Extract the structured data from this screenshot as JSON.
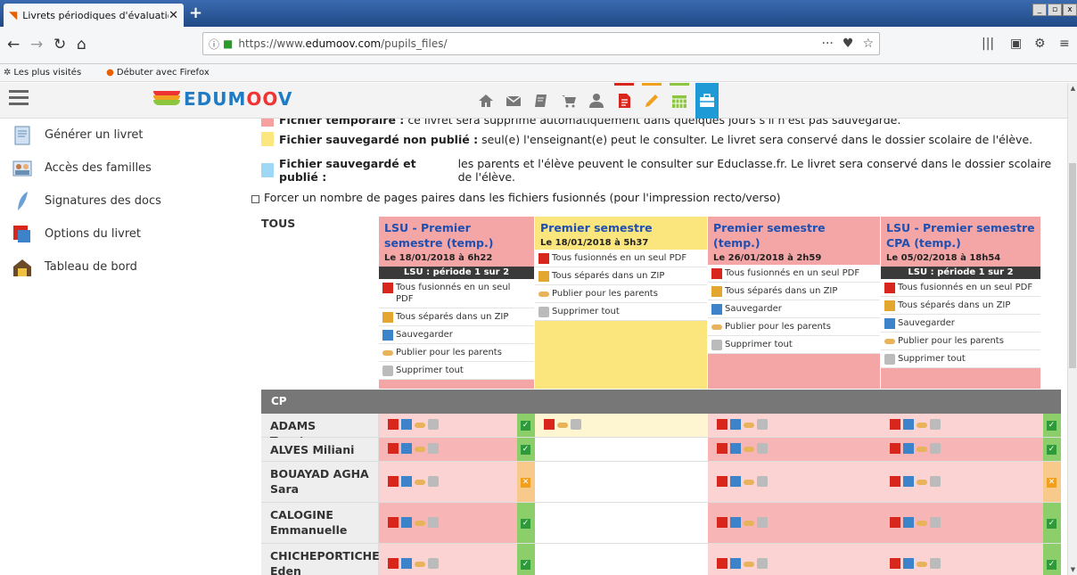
{
  "browser": {
    "tab_title": "Livrets périodiques d'évaluations :",
    "tab_close": "✕",
    "new_tab": "+",
    "url_prefix": "https://www.",
    "url_domain": "edumoov.com",
    "url_path": "/pupils_files/",
    "url_more": "···",
    "bookmarks": [
      "Les plus visités",
      "Débuter avec Firefox"
    ]
  },
  "app": {
    "logo_prefix": "EDUM",
    "logo_oo": "OO",
    "logo_suffix": "V",
    "nav_icons": [
      "home-icon",
      "mail-icon",
      "notebook-icon",
      "cart-icon",
      "user-icon",
      "document-icon",
      "pencil-icon",
      "calendar-icon",
      "briefcase-icon"
    ],
    "nav_colors": {
      "document": "#d9261c",
      "pencil": "#f0a01e",
      "calendar": "#8cc63f",
      "briefcase": "#1e9ad6"
    }
  },
  "sidebar": {
    "items": [
      {
        "label": "Générer un livret",
        "icon": "report-icon"
      },
      {
        "label": "Accès des familles",
        "icon": "family-icon"
      },
      {
        "label": "Signatures des docs",
        "icon": "feather-icon"
      },
      {
        "label": "Options du livret",
        "icon": "options-icon"
      },
      {
        "label": "Tableau de bord",
        "icon": "dashboard-icon"
      }
    ]
  },
  "legend": {
    "temp": {
      "title": "Fichier temporaire :",
      "text": "ce livret sera supprimé automatiquement dans quelques jours s'il n'est pas sauvegardé.",
      "color": "#f7a0a0"
    },
    "saved": {
      "title": "Fichier sauvegardé non publié :",
      "text": "seul(e) l'enseignant(e) peut le consulter. Le livret sera conservé dans le dossier scolaire de l'élève.",
      "color": "#fbe77e"
    },
    "published": {
      "title": "Fichier sauvegardé et publié :",
      "text": "les parents et l'élève peuvent le consulter sur Educlasse.fr. Le livret sera conservé dans le dossier scolaire de l'élève.",
      "color": "#9ed8f5"
    }
  },
  "force_pages_label": "Forcer un nombre de pages paires dans les fichiers fusionnés (pour l'impression recto/verso)",
  "table": {
    "all_label": "TOUS",
    "columns": [
      {
        "title": "LSU - Premier semestre (temp.)",
        "date": "Le 18/01/2018 à 6h22",
        "lsu": "LSU : période 1 sur 2",
        "actions": [
          "Tous fusionnés en un seul PDF",
          "Tous séparés dans un ZIP",
          "Sauvegarder",
          "Publier pour les parents",
          "Supprimer tout"
        ],
        "color": "#f4a6a6"
      },
      {
        "title": "Premier semestre",
        "date": "Le 18/01/2018 à 5h37",
        "lsu": "",
        "actions": [
          "Tous fusionnés en un seul PDF",
          "Tous séparés dans un ZIP",
          "Publier pour les parents",
          "Supprimer tout"
        ],
        "color": "#fbe57d"
      },
      {
        "title": "Premier semestre (temp.)",
        "date": "Le 26/01/2018 à 2h59",
        "lsu": "",
        "actions": [
          "Tous fusionnés en un seul PDF",
          "Tous séparés dans un ZIP",
          "Sauvegarder",
          "Publier pour les parents",
          "Supprimer tout"
        ],
        "color": "#f4a6a6"
      },
      {
        "title": "LSU - Premier semestre CPA (temp.)",
        "date": "Le 05/02/2018 à 18h54",
        "lsu": "LSU : période 1 sur 2",
        "actions": [
          "Tous fusionnés en un seul PDF",
          "Tous séparés dans un ZIP",
          "Sauvegarder",
          "Publier pour les parents",
          "Supprimer tout"
        ],
        "color": "#f4a6a6"
      }
    ],
    "group": "CP",
    "students": [
      {
        "name": "ADAMS Tanetua"
      },
      {
        "name": "ALVES Miliani"
      },
      {
        "name": "BOUAYAD AGHA Sara"
      },
      {
        "name": "CALOGINE Emmanuelle"
      },
      {
        "name": "CHICHEPORTICHE Eden"
      }
    ],
    "status_ok": "✓",
    "status_ko": "✕"
  }
}
